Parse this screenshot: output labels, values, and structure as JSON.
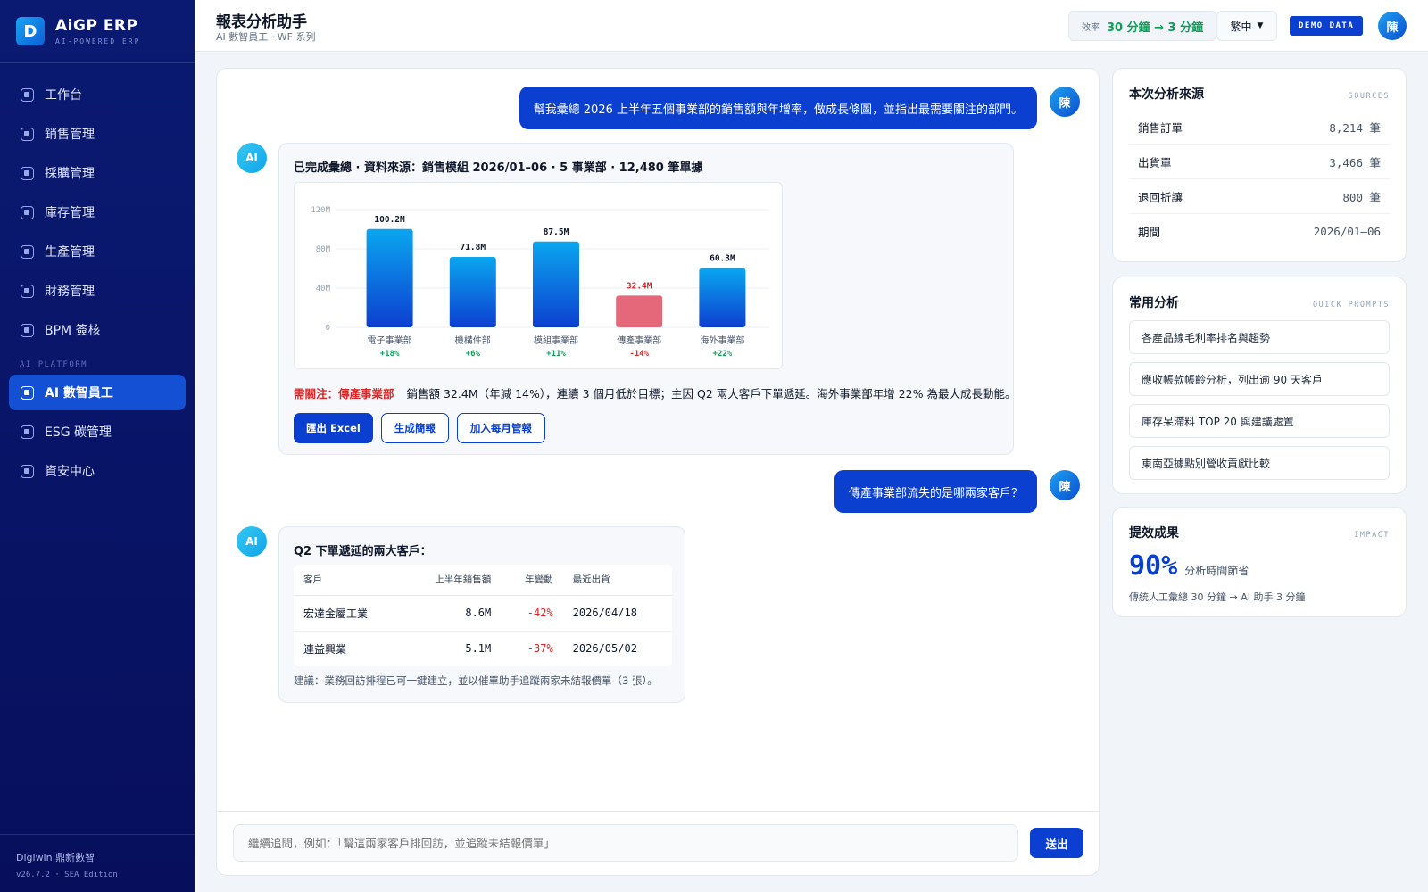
{
  "brand": {
    "logo_letter": "D",
    "name": "AiGP ERP",
    "tagline": "AI-POWERED ERP"
  },
  "nav": {
    "items": [
      {
        "label": "工作台",
        "icon": "module-icon"
      },
      {
        "label": "銷售管理",
        "icon": "module-icon"
      },
      {
        "label": "採購管理",
        "icon": "module-icon"
      },
      {
        "label": "庫存管理",
        "icon": "module-icon"
      },
      {
        "label": "生產管理",
        "icon": "module-icon"
      },
      {
        "label": "財務管理",
        "icon": "module-icon"
      },
      {
        "label": "BPM 簽核",
        "icon": "module-icon"
      }
    ],
    "section_label": "AI PLATFORM",
    "ai_items": [
      {
        "label": "AI 數智員工",
        "active": true
      },
      {
        "label": "ESG 碳管理"
      },
      {
        "label": "資安中心"
      }
    ]
  },
  "footer": {
    "company": "Digiwin 鼎新數智",
    "version": "v26.7.2 · SEA Edition"
  },
  "header": {
    "title": "報表分析助手",
    "subtitle": "AI 數智員工 · WF 系列",
    "efficiency_label": "效率",
    "efficiency_value": "30 分鐘 → 3 分鐘",
    "language": "繁中",
    "demo_badge": "DEMO DATA",
    "user_initial": "陳"
  },
  "chat": {
    "user_msg_1": "幫我彙總 2026 上半年五個事業部的銷售額與年增率，做成長條圖，並指出最需要關注的部門。",
    "ai_label": "AI",
    "ai_reply_1_title": "已完成彙總 · 資料來源：銷售模組 2026/01–06 · 5 事業部 · 12,480 筆單據",
    "attention_tag": "需關注：傳產事業部",
    "attention_text": "銷售額 32.4M（年減 14%），連續 3 個月低於目標；主因 Q2 兩大客戶下單遞延。海外事業部年增 22% 為最大成長動能。",
    "actions": {
      "export": "匯出 Excel",
      "brief": "生成簡報",
      "monthly": "加入每月管報"
    },
    "user_msg_2": "傳產事業部流失的是哪兩家客戶？",
    "ai_reply_2_title": "Q2 下單遞延的兩大客戶：",
    "table": {
      "headers": [
        "客戶",
        "上半年銷售額",
        "年變動",
        "最近出貨"
      ],
      "rows": [
        [
          "宏達金屬工業",
          "8.6M",
          "-42%",
          "2026/04/18"
        ],
        [
          "連益興業",
          "5.1M",
          "-37%",
          "2026/05/02"
        ]
      ]
    },
    "suggestion": "建議：業務回訪排程已可一鍵建立，並以催單助手追蹤兩家未結報價單（3 張）。",
    "input_placeholder": "繼續追問，例如：「幫這兩家客戶排回訪，並追蹤未結報價單」",
    "send_label": "送出"
  },
  "chart_data": {
    "type": "bar",
    "categories": [
      "電子事業部",
      "機構件部",
      "模組事業部",
      "傳產事業部",
      "海外事業部"
    ],
    "values": [
      100.2,
      71.8,
      87.5,
      32.4,
      60.3
    ],
    "value_labels": [
      "100.2M",
      "71.8M",
      "87.5M",
      "32.4M",
      "60.3M"
    ],
    "growth": [
      "+18%",
      "+6%",
      "+11%",
      "-14%",
      "+22%"
    ],
    "highlight_index": 3,
    "yticks": [
      "0",
      "40M",
      "80M",
      "120M"
    ],
    "ylim": [
      0,
      120
    ],
    "grid": true,
    "colors": {
      "bar_top": "#0aa6ef",
      "bar_bottom": "#0d3fd0",
      "highlight": "#e5677a",
      "positive": "#0f9d58",
      "negative": "#dc2626"
    }
  },
  "sources": {
    "title": "本次分析來源",
    "tag": "SOURCES",
    "rows": [
      {
        "label": "銷售訂單",
        "value": "8,214 筆"
      },
      {
        "label": "出貨單",
        "value": "3,466 筆"
      },
      {
        "label": "退回折讓",
        "value": "800 筆"
      },
      {
        "label": "期間",
        "value": "2026/01–06"
      }
    ]
  },
  "prompts": {
    "title": "常用分析",
    "tag": "QUICK PROMPTS",
    "items": [
      "各產品線毛利率排名與趨勢",
      "應收帳款帳齡分析，列出逾 90 天客戶",
      "庫存呆滯料 TOP 20 與建議處置",
      "東南亞據點別營收貢獻比較"
    ]
  },
  "impact": {
    "title": "提效成果",
    "tag": "IMPACT",
    "percent": "90%",
    "percent_label": "分析時間節省",
    "note": "傳統人工彙總 30 分鐘 → AI 助手 3 分鐘"
  }
}
